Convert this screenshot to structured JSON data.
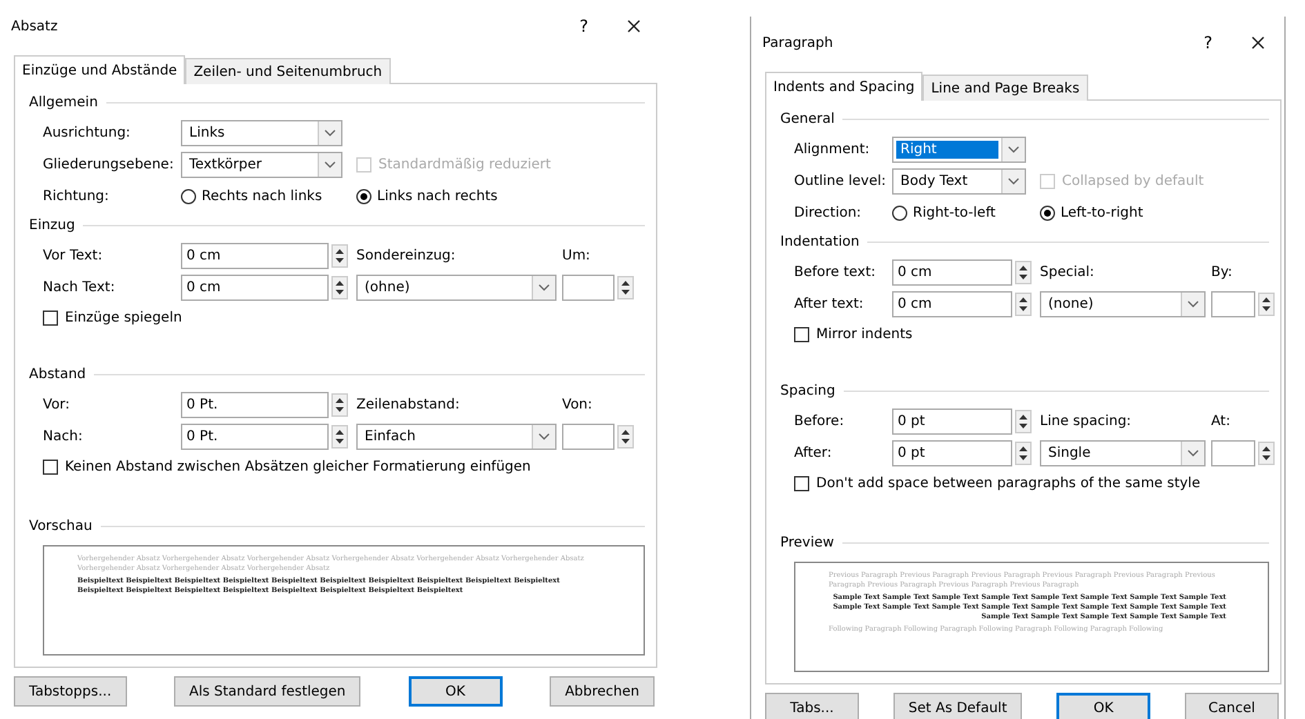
{
  "dialogs": [
    {
      "title": "Absatz",
      "help": "?",
      "tabs": [
        {
          "label": "Einzüge und Abstände",
          "selected": true
        },
        {
          "label": "Zeilen- und Seitenumbruch",
          "selected": false
        }
      ],
      "general": {
        "heading": "Allgemein",
        "alignment": {
          "label": "Ausrichtung:",
          "value": "Links",
          "highlighted": false
        },
        "outline": {
          "label": "Gliederungsebene:",
          "value": "Textkörper"
        },
        "collapsed": {
          "label": "Standardmäßig reduziert",
          "checked": false,
          "disabled": true
        },
        "direction": {
          "label": "Richtung:",
          "options": [
            {
              "label": "Rechts nach links",
              "selected": false
            },
            {
              "label": "Links nach rechts",
              "selected": true
            }
          ]
        }
      },
      "indentation": {
        "heading": "Einzug",
        "before": {
          "label": "Vor Text:",
          "value": "0 cm"
        },
        "after": {
          "label": "Nach Text:",
          "value": "0 cm"
        },
        "special": {
          "label": "Sondereinzug:",
          "value": "(ohne)"
        },
        "by": {
          "label": "Um:"
        },
        "mirror": {
          "label": "Einzüge spiegeln",
          "checked": false
        }
      },
      "spacing": {
        "heading": "Abstand",
        "before": {
          "label": "Vor:",
          "value": "0 Pt."
        },
        "after": {
          "label": "Nach:",
          "value": "0 Pt."
        },
        "line_spacing": {
          "label": "Zeilenabstand:",
          "value": "Einfach"
        },
        "at": {
          "label": "Von:"
        },
        "no_space": {
          "label": "Keinen Abstand zwischen Absätzen gleicher Formatierung einfügen",
          "checked": false
        }
      },
      "preview": {
        "heading": "Vorschau",
        "previous": "Vorhergehender Absatz Vorhergehender Absatz Vorhergehender Absatz Vorhergehender Absatz Vorhergehender Absatz Vorhergehender Absatz Vorhergehender Absatz Vorhergehender Absatz Vorhergehender Absatz",
        "sample": "Beispieltext Beispieltext Beispieltext Beispieltext Beispieltext Beispieltext Beispieltext Beispieltext Beispieltext Beispieltext Beispieltext Beispieltext Beispieltext Beispieltext Beispieltext Beispieltext Beispieltext Beispieltext",
        "sample_align_right": false
      },
      "buttons": [
        {
          "label": "Tabstopps...",
          "default": false
        },
        {
          "label": "Als Standard festlegen",
          "default": false
        },
        {
          "label": "OK",
          "default": true
        },
        {
          "label": "Abbrechen",
          "default": false
        }
      ]
    },
    {
      "title": "Paragraph",
      "help": "?",
      "tabs": [
        {
          "label": "Indents and Spacing",
          "selected": true
        },
        {
          "label": "Line and Page Breaks",
          "selected": false
        }
      ],
      "general": {
        "heading": "General",
        "alignment": {
          "label": "Alignment:",
          "value": "Right",
          "highlighted": true
        },
        "outline": {
          "label": "Outline level:",
          "value": "Body Text"
        },
        "collapsed": {
          "label": "Collapsed by default",
          "checked": false,
          "disabled": true
        },
        "direction": {
          "label": "Direction:",
          "options": [
            {
              "label": "Right-to-left",
              "selected": false
            },
            {
              "label": "Left-to-right",
              "selected": true
            }
          ]
        }
      },
      "indentation": {
        "heading": "Indentation",
        "before": {
          "label": "Before text:",
          "value": "0 cm"
        },
        "after": {
          "label": "After text:",
          "value": "0 cm"
        },
        "special": {
          "label": "Special:",
          "value": "(none)"
        },
        "by": {
          "label": "By:"
        },
        "mirror": {
          "label": "Mirror indents",
          "checked": false
        }
      },
      "spacing": {
        "heading": "Spacing",
        "before": {
          "label": "Before:",
          "value": "0 pt"
        },
        "after": {
          "label": "After:",
          "value": "0 pt"
        },
        "line_spacing": {
          "label": "Line spacing:",
          "value": "Single"
        },
        "at": {
          "label": "At:"
        },
        "no_space": {
          "label": "Don't add space between paragraphs of the same style",
          "checked": false
        }
      },
      "preview": {
        "heading": "Preview",
        "previous": "Previous Paragraph Previous Paragraph Previous Paragraph Previous Paragraph Previous Paragraph Previous Paragraph Previous Paragraph Previous Paragraph Previous Paragraph",
        "sample": "Sample Text Sample Text Sample Text Sample Text Sample Text Sample Text Sample Text Sample Text Sample Text Sample Text Sample Text Sample Text Sample Text Sample Text Sample Text Sample Text Sample Text Sample Text Sample Text Sample Text Sample Text",
        "sample_align_right": true,
        "following": "Following Paragraph Following Paragraph Following Paragraph Following Paragraph Following"
      },
      "buttons": [
        {
          "label": "Tabs...",
          "default": false
        },
        {
          "label": "Set As Default",
          "default": false
        },
        {
          "label": "OK",
          "default": true
        },
        {
          "label": "Cancel",
          "default": false
        }
      ]
    }
  ]
}
